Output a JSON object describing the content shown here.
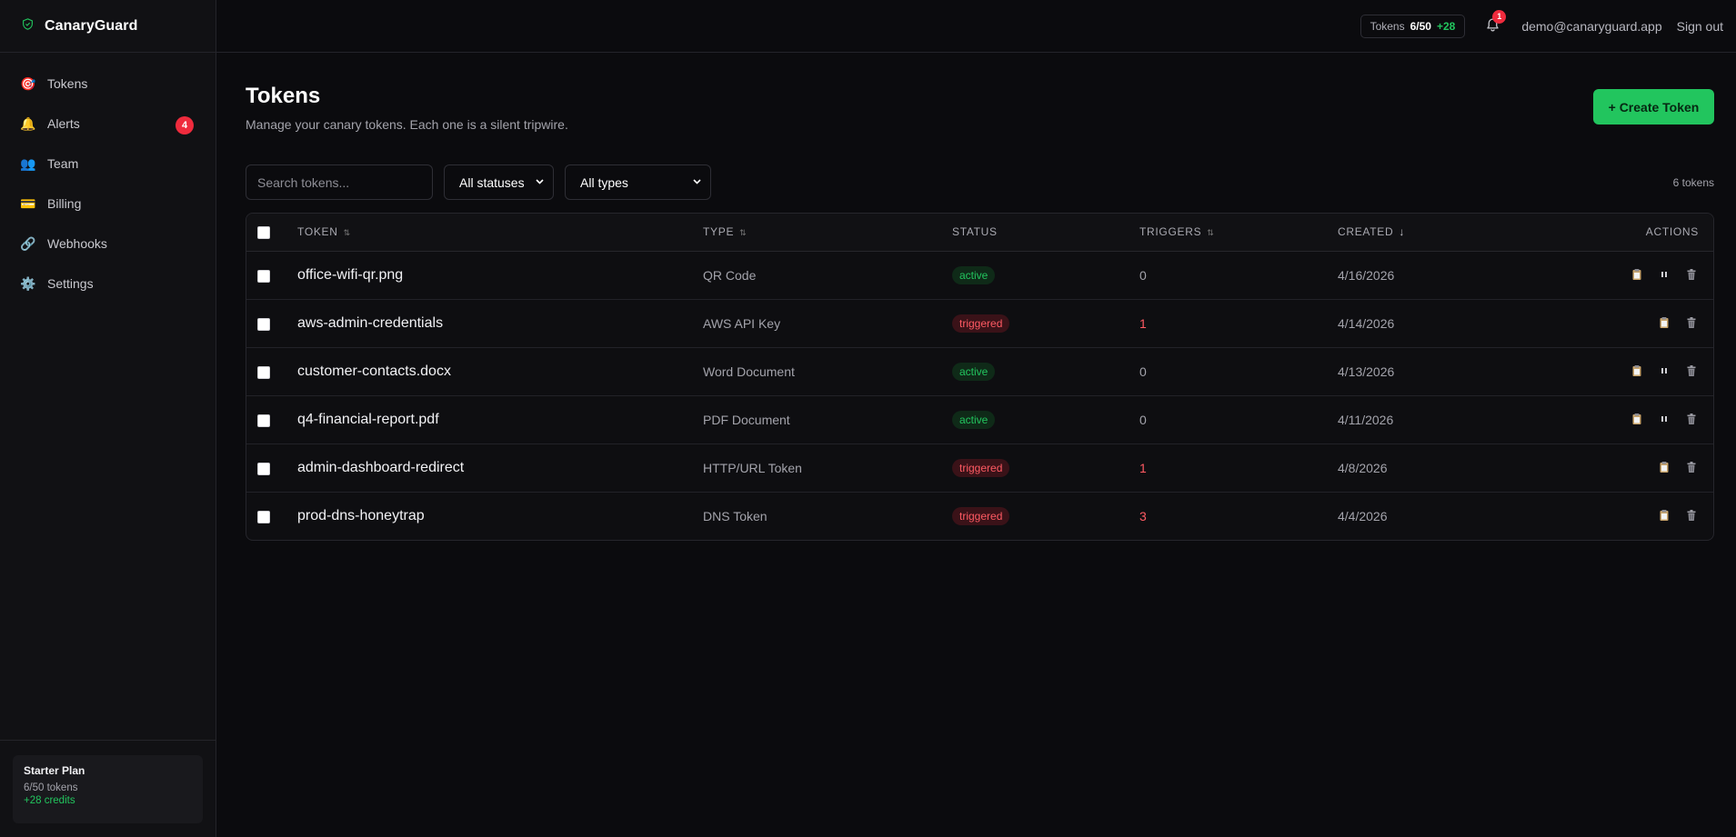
{
  "app": {
    "name": "CanaryGuard",
    "colors": {
      "accent": "#22c55e",
      "danger": "#ef2b3d",
      "bg": "#0b0b0e"
    }
  },
  "sidebar": {
    "items": [
      {
        "label": "Tokens",
        "icon": "target-icon",
        "glyph": "🎯"
      },
      {
        "label": "Alerts",
        "icon": "bell-icon",
        "glyph": "🔔",
        "badge": "4"
      },
      {
        "label": "Team",
        "icon": "users-icon",
        "glyph": "👥"
      },
      {
        "label": "Billing",
        "icon": "credit-card-icon",
        "glyph": "💳"
      },
      {
        "label": "Webhooks",
        "icon": "link-icon",
        "glyph": "🔗"
      },
      {
        "label": "Settings",
        "icon": "gear-icon",
        "glyph": "⚙️"
      }
    ],
    "plan": {
      "name": "Starter Plan",
      "tokens": "6/50 tokens",
      "credits": "+28 credits"
    }
  },
  "topbar": {
    "tokens_label": "Tokens",
    "tokens_value": "6/50",
    "tokens_plus": "+28",
    "notif_count": "1",
    "email": "demo@canaryguard.app",
    "signout": "Sign out"
  },
  "page": {
    "title": "Tokens",
    "subtitle": "Manage your canary tokens. Each one is a silent tripwire.",
    "create_label": "+ Create Token"
  },
  "filters": {
    "search_placeholder": "Search tokens...",
    "status_selected": "All statuses",
    "type_selected": "All types",
    "count": "6 tokens"
  },
  "table": {
    "headers": {
      "token": "TOKEN",
      "type": "TYPE",
      "status": "STATUS",
      "triggers": "TRIGGERS",
      "created": "CREATED",
      "actions": "ACTIONS"
    },
    "rows": [
      {
        "name": "office-wifi-qr.png",
        "type": "QR Code",
        "status": "active",
        "triggers": "0",
        "created": "4/16/2026",
        "can_pause": true
      },
      {
        "name": "aws-admin-credentials",
        "type": "AWS API Key",
        "status": "triggered",
        "triggers": "1",
        "created": "4/14/2026",
        "can_pause": false
      },
      {
        "name": "customer-contacts.docx",
        "type": "Word Document",
        "status": "active",
        "triggers": "0",
        "created": "4/13/2026",
        "can_pause": true
      },
      {
        "name": "q4-financial-report.pdf",
        "type": "PDF Document",
        "status": "active",
        "triggers": "0",
        "created": "4/11/2026",
        "can_pause": true
      },
      {
        "name": "admin-dashboard-redirect",
        "type": "HTTP/URL Token",
        "status": "triggered",
        "triggers": "1",
        "created": "4/8/2026",
        "can_pause": false
      },
      {
        "name": "prod-dns-honeytrap",
        "type": "DNS Token",
        "status": "triggered",
        "triggers": "3",
        "created": "4/4/2026",
        "can_pause": false
      }
    ]
  }
}
